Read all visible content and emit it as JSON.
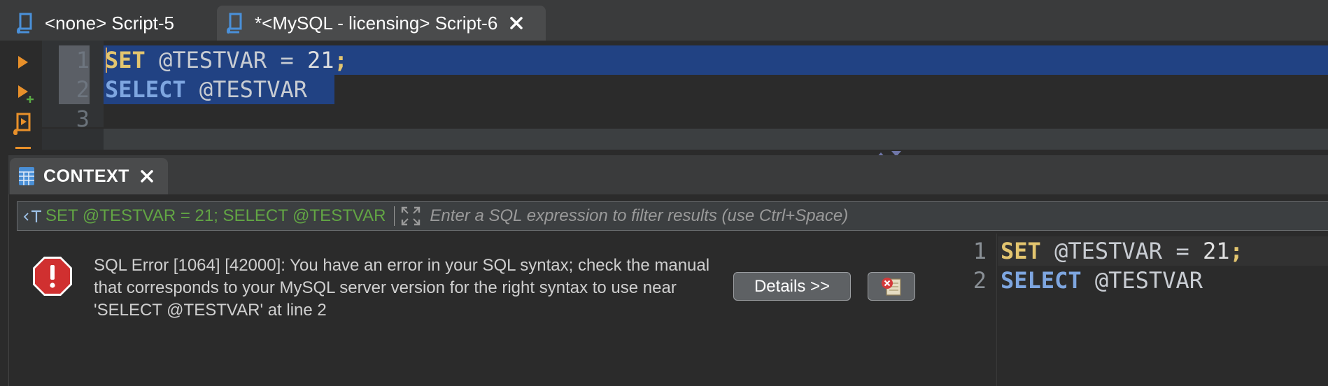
{
  "tabs": [
    {
      "label": "<none> Script-5",
      "active": false
    },
    {
      "label": "*<MySQL - licensing> Script-6",
      "active": true
    }
  ],
  "editor": {
    "line_numbers": [
      "1",
      "2",
      "3"
    ],
    "line1": {
      "keyword": "SET",
      "rest": " @TESTVAR = ",
      "number": "21",
      "terminator": ";"
    },
    "line2": {
      "keyword": "SELECT",
      "rest": " @TESTVAR"
    }
  },
  "results_panel": {
    "tab_label": "CONTEXT",
    "filter": {
      "query_text": "SET @TESTVAR = 21; SELECT @TESTVAR",
      "placeholder": "Enter a SQL expression to filter results (use Ctrl+Space)"
    },
    "error": {
      "message": "SQL Error [1064] [42000]: You have an error in your SQL syntax; check the manual that corresponds to your MySQL server version for the right syntax to use near 'SELECT @TESTVAR' at line 2",
      "details_button": "Details >>"
    },
    "query_preview": {
      "line_numbers": [
        "1",
        "2"
      ],
      "line1": {
        "keyword": "SET",
        "rest": " @TESTVAR = ",
        "number": "21",
        "terminator": ";"
      },
      "line2": {
        "keyword": "SELECT",
        "rest": " @TESTVAR"
      }
    }
  },
  "colors": {
    "background": "#2b2b2b",
    "selection": "#214283",
    "keyword_set": "#e3c56f",
    "keyword_select": "#7ea6e0",
    "filter_query": "#62a544",
    "error_red": "#d03030",
    "tool_orange": "#e8902a",
    "tab_icon_blue": "#4a90d9"
  }
}
